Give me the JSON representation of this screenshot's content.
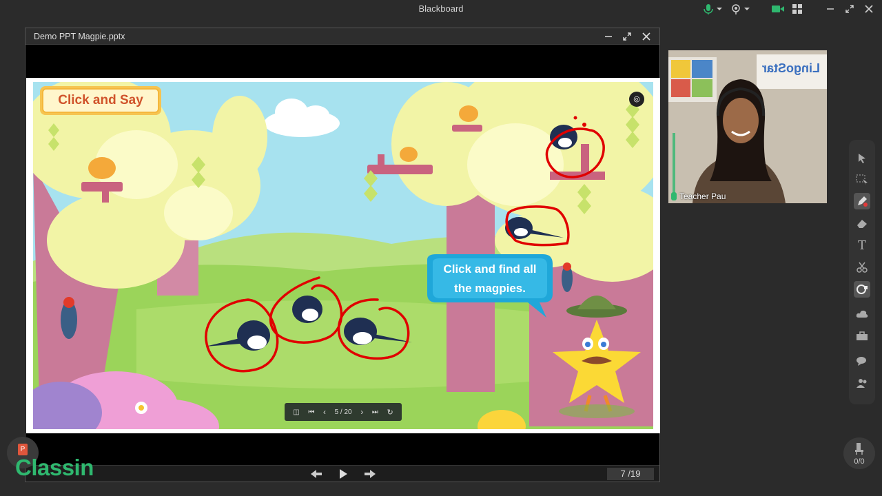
{
  "app": {
    "title": "Blackboard"
  },
  "ppt_window": {
    "title": "Demo PPT Magpie.pptx"
  },
  "slide": {
    "badge_text": "Click and Say",
    "bubble_line1": "Click and find all",
    "bubble_line2": "the magpies.",
    "nav_counter": "5 / 20"
  },
  "ppt_controls": {
    "page_counter": "7 /19"
  },
  "video": {
    "teacher_name": "Teacher Pau",
    "poster_text": "LingoStar"
  },
  "seat_widget": {
    "count": "0/0"
  },
  "branding": {
    "logo_text": "Classin",
    "ppt_badge_letter": "P"
  },
  "colors": {
    "accent_green": "#2fb86f",
    "annotation_red": "#e00000"
  },
  "icons": [
    "mic-icon",
    "camera-icon",
    "grid-icon",
    "minimize-icon",
    "restore-icon",
    "close-icon",
    "pointer-icon",
    "select-icon",
    "pen-icon",
    "eraser-icon",
    "text-icon",
    "scissors-icon",
    "shape-icon",
    "cloud-icon",
    "toolbox-icon",
    "chat-icon",
    "users-icon"
  ]
}
